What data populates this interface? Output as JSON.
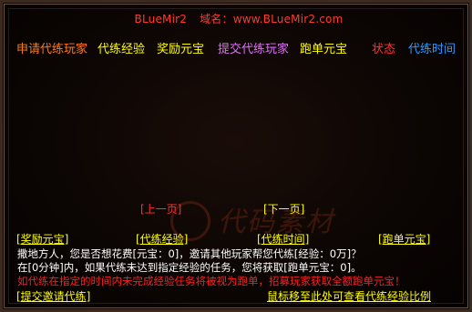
{
  "header": {
    "app_name": "BLueMir2",
    "domain_label": "域名：",
    "domain_value": "www.BLueMir2.com"
  },
  "top_nav": [
    {
      "label": "申请代练玩家",
      "color": "#ff7b1c"
    },
    {
      "label": "代练经验",
      "color": "#ffff00"
    },
    {
      "label": "奖励元宝",
      "color": "#ffff00"
    },
    {
      "label": "提交代练玩家",
      "color": "#e070ff"
    },
    {
      "label": "跑单元宝",
      "color": "#ffff00"
    },
    {
      "label": "状态",
      "color": "#ff3030"
    },
    {
      "label": "代练时间",
      "color": "#2f9bff"
    }
  ],
  "pager": {
    "prev": "[上一页]",
    "next": "[下一页]",
    "prev_color": "#ff3030",
    "next_color": "#ffff00"
  },
  "columns": [
    "[奖励元宝]",
    "[代练经验]",
    "[代练时间]",
    "[跑单元宝]"
  ],
  "info_lines": [
    {
      "text": "撒地方人，您是否想花费[元宝：0]，邀请其他玩家帮您代练[经验：0万]？",
      "color": "#ffffff"
    },
    {
      "text": "在[0分钟]内，如果代练未达到指定经验的任务，您将获取[跑单元宝：0]。",
      "color": "#ffffff"
    },
    {
      "text": "如代练在指定的时间内未完成经验任务将被视为跑单，招募玩家获取全额跑单元宝！",
      "color": "#ff2020"
    }
  ],
  "footer": {
    "submit_label": "[提交邀请代练]",
    "hint_label": "鼠标移至此处可查看代练经验比例",
    "submit_color": "#ffff00",
    "hint_color": "#ffff00"
  },
  "watermark_text": "代码素材"
}
